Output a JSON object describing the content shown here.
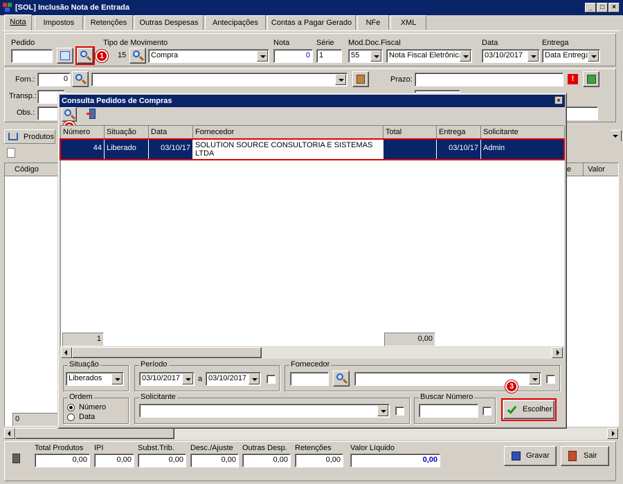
{
  "window": {
    "title": "[SOL] Inclusão Nota de Entrada",
    "controls": [
      "_",
      "□",
      "×"
    ]
  },
  "tabs": [
    "Nota",
    "Impostos",
    "Retenções",
    "Outras Despesas",
    "Antecipações",
    "Contas a Pagar Gerado",
    "NFe",
    "XML"
  ],
  "header": {
    "pedido_label": "Pedido",
    "pedido_value": "",
    "tipo_label": "Tipo de Movimento",
    "tipo_code": "15",
    "tipo_value": "Compra",
    "nota_label": "Nota",
    "nota_value": "0",
    "serie_label": "Série",
    "serie_value": "1",
    "mod_label": "Mod.Doc.Fiscal",
    "mod_code": "55",
    "mod_value": "Nota Fiscal Eletrônica",
    "data_label": "Data",
    "data_value": "03/10/2017",
    "entrega_label": "Entrega",
    "entrega_value": "Data Entrega"
  },
  "supplier": {
    "forn_label": "Forn.:",
    "forn_value": "0",
    "forn_name": "",
    "transp_label": "Transp.:",
    "obs_label": "Obs.:",
    "prazo_label": "Prazo:",
    "prazo_value": ""
  },
  "items": {
    "tab_label": "Produtos",
    "col_codigo": "Código",
    "col_e": "e",
    "col_valor": "Valor",
    "footer_value": "0"
  },
  "dialog": {
    "title": "Consulta Pedidos de Compras",
    "columns": [
      "Número",
      "Situação",
      "Data",
      "Fornecedor",
      "Total",
      "Entrega",
      "Solicitante"
    ],
    "rows": [
      {
        "numero": "44",
        "situacao": "Liberado",
        "data": "03/10/17",
        "fornecedor_l1": "SOLUTION SOURCE CONSULTORIA E SISTEMAS",
        "fornecedor_l2": "LTDA",
        "total": "",
        "entrega": "03/10/17",
        "solicitante": "Admin"
      }
    ],
    "footer_count": "1",
    "footer_total": "0,00",
    "situacao_label": "Situação",
    "situacao_value": "Liberados",
    "periodo_label": "Período",
    "periodo_from": "03/10/2017",
    "periodo_sep": "a",
    "periodo_to": "03/10/2017",
    "fornecedor_label": "Fornecedor",
    "fornecedor_value": "",
    "ordem_label": "Ordem",
    "ordem_options": [
      "Número",
      "Data"
    ],
    "ordem_selected": "Número",
    "solicitante_label": "Solicitante",
    "solicitante_value": "",
    "buscar_label": "Buscar Número",
    "buscar_value": "",
    "escolher_label": "Escolher"
  },
  "badges": [
    "1",
    "2",
    "3"
  ],
  "totals": {
    "total_produtos_label": "Total Produtos",
    "total_produtos": "0,00",
    "ipi_label": "IPI",
    "ipi": "0,00",
    "subst_label": "Subst.Trib.",
    "subst": "0,00",
    "desc_label": "Desc./Ajuste",
    "desc": "0,00",
    "outras_label": "Outras Desp.",
    "outras": "0,00",
    "retencoes_label": "Retenções",
    "retencoes": "0,00",
    "liquido_label": "Valor Líquido",
    "liquido": "0,00",
    "gravar_label": "Gravar",
    "sair_label": "Sair"
  },
  "colors": {
    "titlebar": "#0a246a",
    "selection": "#0a246a",
    "highlight": "#e00000",
    "face": "#d4d0c8",
    "liquido_text": "#0000cc"
  }
}
